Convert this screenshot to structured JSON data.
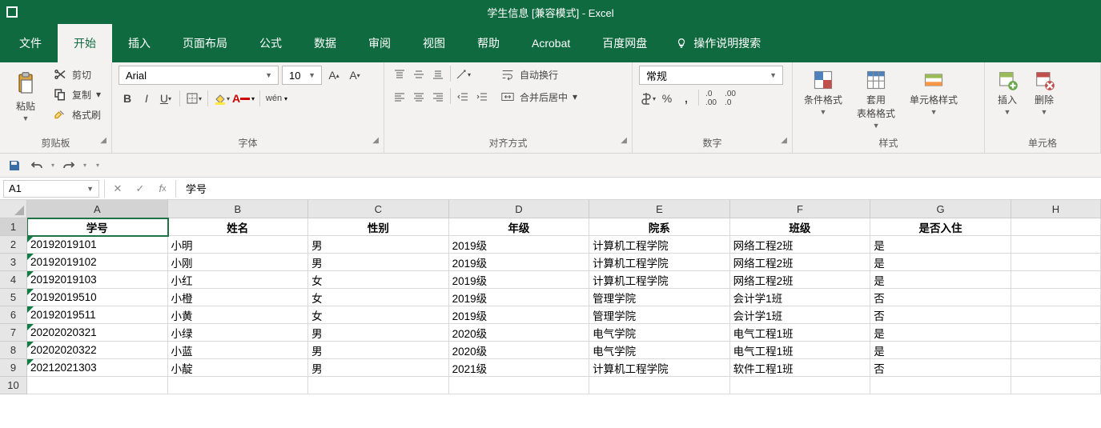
{
  "title": "学生信息  [兼容模式]  -  Excel",
  "tabs": {
    "file": "文件",
    "home": "开始",
    "insert": "插入",
    "layout": "页面布局",
    "formulas": "公式",
    "data": "数据",
    "review": "审阅",
    "view": "视图",
    "help": "帮助",
    "acrobat": "Acrobat",
    "baidu": "百度网盘",
    "tellme": "操作说明搜索"
  },
  "ribbon": {
    "clipboard": {
      "label": "剪贴板",
      "paste": "粘贴",
      "cut": "剪切",
      "copy": "复制",
      "painter": "格式刷"
    },
    "font": {
      "label": "字体",
      "name": "Arial",
      "size": "10"
    },
    "align": {
      "label": "对齐方式",
      "wrap": "自动换行",
      "merge": "合并后居中"
    },
    "number": {
      "label": "数字",
      "format": "常规"
    },
    "styles": {
      "label": "样式",
      "cond": "条件格式",
      "table": "套用\n表格格式",
      "cell": "单元格样式"
    },
    "cells": {
      "label": "单元格",
      "insert": "插入",
      "delete": "删除"
    }
  },
  "nameBox": "A1",
  "formulaValue": "学号",
  "columns": [
    "A",
    "B",
    "C",
    "D",
    "E",
    "F",
    "G",
    "H"
  ],
  "headers": [
    "学号",
    "姓名",
    "性别",
    "年级",
    "院系",
    "班级",
    "是否入住"
  ],
  "rows": [
    [
      "20192019101",
      "小明",
      "男",
      "2019级",
      "计算机工程学院",
      "网络工程2班",
      "是"
    ],
    [
      "20192019102",
      "小刚",
      "男",
      "2019级",
      "计算机工程学院",
      "网络工程2班",
      "是"
    ],
    [
      "20192019103",
      "小红",
      "女",
      "2019级",
      "计算机工程学院",
      "网络工程2班",
      "是"
    ],
    [
      "20192019510",
      "小橙",
      "女",
      "2019级",
      "管理学院",
      "会计学1班",
      "否"
    ],
    [
      "20192019511",
      "小黄",
      "女",
      "2019级",
      "管理学院",
      "会计学1班",
      "否"
    ],
    [
      "20202020321",
      "小绿",
      "男",
      "2020级",
      "电气学院",
      "电气工程1班",
      "是"
    ],
    [
      "20202020322",
      "小蓝",
      "男",
      "2020级",
      "电气学院",
      "电气工程1班",
      "是"
    ],
    [
      "20212021303",
      "小靛",
      "男",
      "2021级",
      "计算机工程学院",
      "软件工程1班",
      "否"
    ]
  ]
}
